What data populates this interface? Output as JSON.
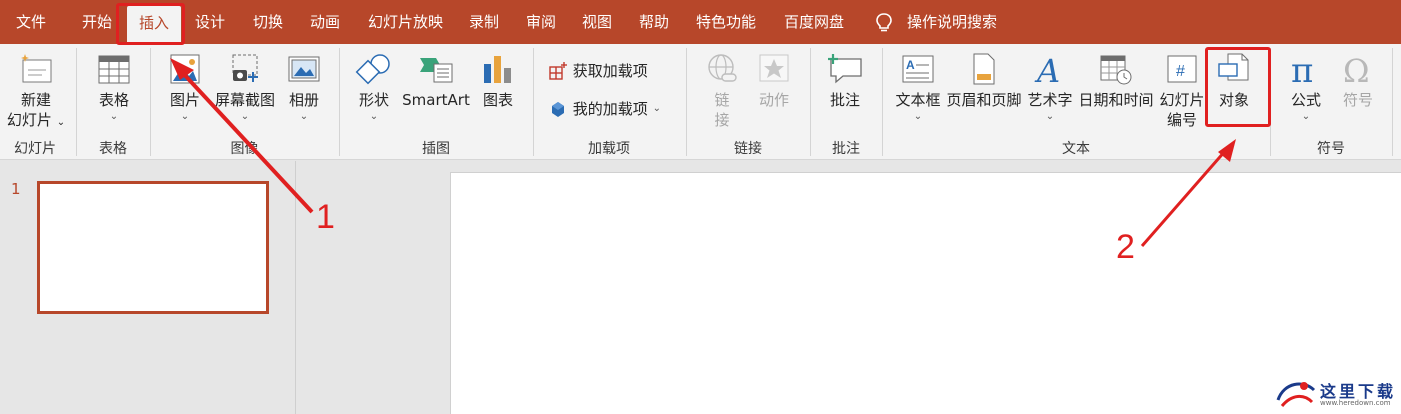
{
  "tabs": [
    {
      "label": "文件",
      "active": false
    },
    {
      "label": "开始",
      "active": false
    },
    {
      "label": "插入",
      "active": true
    },
    {
      "label": "设计",
      "active": false
    },
    {
      "label": "切换",
      "active": false
    },
    {
      "label": "动画",
      "active": false
    },
    {
      "label": "幻灯片放映",
      "active": false
    },
    {
      "label": "录制",
      "active": false
    },
    {
      "label": "审阅",
      "active": false
    },
    {
      "label": "视图",
      "active": false
    },
    {
      "label": "帮助",
      "active": false
    },
    {
      "label": "特色功能",
      "active": false
    },
    {
      "label": "百度网盘",
      "active": false
    }
  ],
  "search": {
    "label": "操作说明搜索",
    "icon": "lightbulb-icon"
  },
  "ribbon": {
    "groups": {
      "slides": "幻灯片",
      "tables": "表格",
      "images": "图像",
      "illustrations": "插图",
      "addins": "加载项",
      "links": "链接",
      "comments": "批注",
      "text": "文本",
      "symbols": "符号"
    },
    "buttons": {
      "new_slide_1": "新建",
      "new_slide_2": "幻灯片",
      "table": "表格",
      "pictures": "图片",
      "screenshot": "屏幕截图",
      "album": "相册",
      "shapes": "形状",
      "smartart": "SmartArt",
      "chart": "图表",
      "get_addins": "获取加载项",
      "my_addins": "我的加载项",
      "link_1": "链",
      "link_2": "接",
      "action": "动作",
      "comment": "批注",
      "textbox": "文本框",
      "header_footer": "页眉和页脚",
      "wordart": "艺术字",
      "datetime": "日期和时间",
      "slide_number_1": "幻灯片",
      "slide_number_2": "编号",
      "object": "对象",
      "equation": "公式",
      "symbol": "符号"
    },
    "disabled": [
      "link",
      "action",
      "symbol"
    ]
  },
  "slides_pane": {
    "slide_number": "1"
  },
  "annotations": {
    "n1": "1",
    "n2": "2"
  },
  "watermark": {
    "text": "这里下载",
    "sub": "www.heredown.com"
  },
  "colors": {
    "accent": "#b7472a",
    "annotation": "#e02020",
    "ribbon_bg": "#f3f3f3",
    "workspace_bg": "#e6e6e6"
  }
}
